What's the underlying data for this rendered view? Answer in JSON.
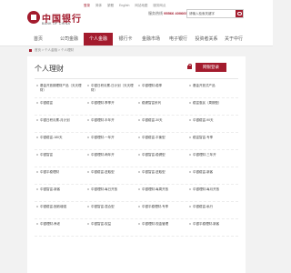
{
  "header": {
    "logo": {
      "cn": "中国银行",
      "en": "BANK OF CHINA"
    },
    "util_links": [
      "登录",
      "简体",
      "繁體",
      "English",
      "网站地图",
      "服务网点"
    ],
    "phone_label": "服务热线",
    "phone_number": "95566",
    "phone_extra": "4006695566",
    "search": {
      "value": "请输入检索关键字"
    }
  },
  "nav": {
    "items": [
      {
        "label": "首页"
      },
      {
        "label": "公司金融"
      },
      {
        "label": "个人金融"
      },
      {
        "label": "银行卡"
      },
      {
        "label": "金融市场"
      },
      {
        "label": "电子银行"
      },
      {
        "label": "投资者关系"
      },
      {
        "label": "关于中行"
      }
    ]
  },
  "breadcrumb": [
    "首页",
    "个人金融",
    "个人理财"
  ],
  "main": {
    "title": "个人理财",
    "login_button": "网银登录"
  },
  "products": [
    "基金开放期理财产品（天天理财）",
    "中银日积月累-日计划（天天理财）",
    "中银理财-稳享",
    "基金开放式产品",
    "中银稳富",
    "中银理财-季季开",
    "稳健智富系列",
    "稳富惠民（周期型）",
    "中银日积月累-月计划",
    "中银理财-半年开",
    "中银稳富-30天",
    "中银稳富-90天",
    "中银稳富-180天",
    "中银理财-一年开",
    "中银稳富-平衡型",
    "稳富智富-专享",
    "中银智富",
    "中银理财-两年开",
    "中银智富-稳健型",
    "中银理财-三年开",
    "中银平稳理财",
    "中银稳富-进取型",
    "中银智富-进取型",
    "中银稳富-新客",
    "中银智富-新客",
    "中银理财-每日开放",
    "中银理财-每周开放",
    "中银理财-每月开放",
    "中银稳富-固收增强",
    "中银智富-混合型",
    "中银平稳理财-专享",
    "中银稳富-私行",
    "中银理财-养老",
    "中银智富-权益",
    "中银理财-现金管理",
    "中银平稳理财-新客"
  ]
}
